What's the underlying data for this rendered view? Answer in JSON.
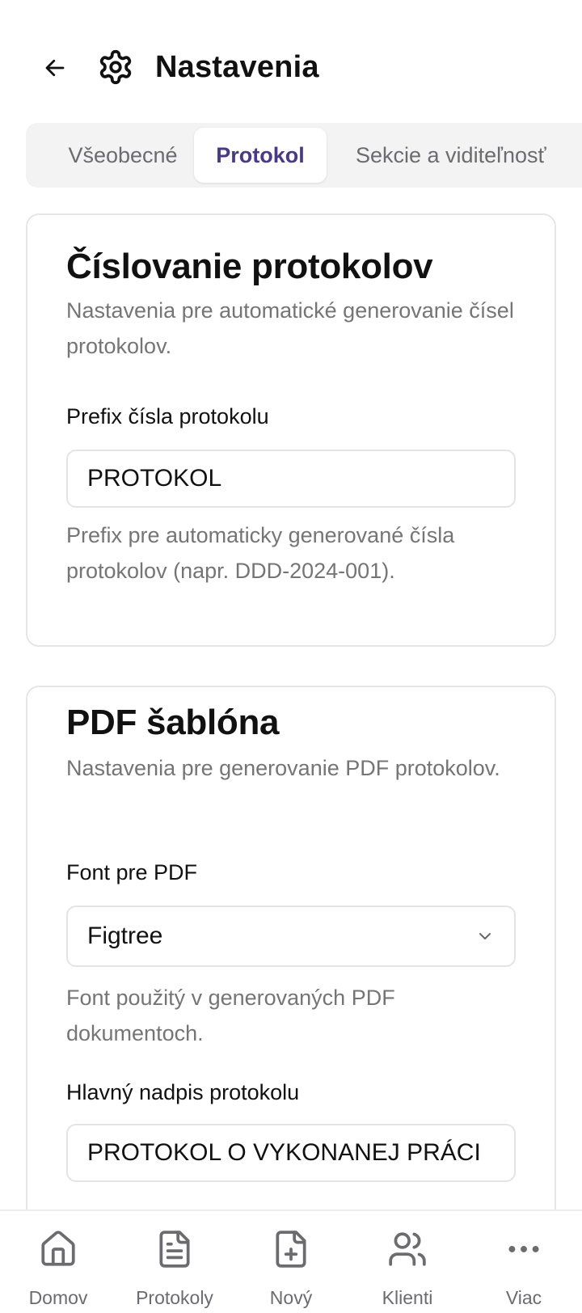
{
  "header": {
    "title": "Nastavenia"
  },
  "tabs": [
    {
      "label": "Všeobecné",
      "active": false
    },
    {
      "label": "Protokol",
      "active": true
    },
    {
      "label": "Sekcie a viditeľnosť",
      "active": false
    }
  ],
  "numbering": {
    "title": "Číslovanie protokolov",
    "description": "Nastavenia pre automatické generovanie čísel protokolov.",
    "prefix_label": "Prefix čísla protokolu",
    "prefix_value": "PROTOKOL",
    "prefix_help": "Prefix pre automaticky generované čísla protokolov (napr. DDD-2024-001)."
  },
  "pdf": {
    "title": "PDF šablóna",
    "description": "Nastavenia pre generovanie PDF protokolov.",
    "font_label": "Font pre PDF",
    "font_value": "Figtree",
    "font_help": "Font použitý v generovaných PDF dokumentoch.",
    "heading_label": "Hlavný nadpis protokolu",
    "heading_value": "PROTOKOL O VYKONANEJ PRÁCI"
  },
  "bottom_nav": [
    {
      "label": "Domov",
      "icon": "home-icon"
    },
    {
      "label": "Protokoly",
      "icon": "document-icon"
    },
    {
      "label": "Nový",
      "icon": "file-plus-icon"
    },
    {
      "label": "Klienti",
      "icon": "users-icon"
    },
    {
      "label": "Viac",
      "icon": "more-dots-icon"
    }
  ],
  "colors": {
    "accent": "#4a3a86",
    "muted": "#757575",
    "border": "#e6e6e8"
  }
}
